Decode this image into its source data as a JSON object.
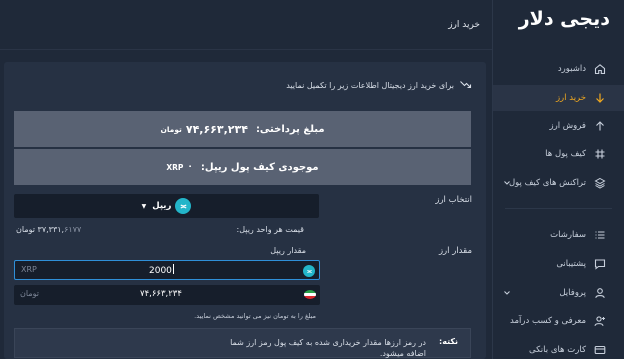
{
  "app": {
    "logo": "دیجی دلار"
  },
  "header": {
    "title": "خرید ارز"
  },
  "sidebar": {
    "items": [
      {
        "label": "داشبورد",
        "icon": "home-icon"
      },
      {
        "label": "خرید ارز",
        "icon": "arrow-down-icon",
        "active": true
      },
      {
        "label": "فروش ارز",
        "icon": "arrow-up-icon"
      },
      {
        "label": "کیف پول ها",
        "icon": "hash-icon"
      },
      {
        "label": "تراکنش های کیف پول",
        "icon": "layers-icon",
        "has_submenu": true
      },
      {
        "label": "سفارشات",
        "icon": "list-icon"
      },
      {
        "label": "پشتیبانی",
        "icon": "chat-icon"
      },
      {
        "label": "پروفایل",
        "icon": "user-icon",
        "has_submenu": true
      },
      {
        "label": "معرفی و کسب درآمد",
        "icon": "user-plus-icon"
      },
      {
        "label": "کارت های بانکی",
        "icon": "card-icon"
      }
    ]
  },
  "main": {
    "intro": "برای خرید ارز دیجیتال اطلاعات زیر را تکمیل نمایید",
    "payment": {
      "label": "مبلغ پرداختی:",
      "value": "۷۴,۶۶۳,۲۳۴",
      "unit": "تومان"
    },
    "balance": {
      "label": "موجودی کیف پول ریپل:",
      "value": "۰",
      "unit": "XRP"
    },
    "currency_select": {
      "label": "انتخاب ارز",
      "selected": "ریپل",
      "caret": "▼",
      "icon": "ripple-icon"
    },
    "rate": {
      "label": "قیمت هر واحد ریپل:",
      "value_int": "۳۷,۳۳۱,",
      "value_dec": "۶۱۷۷",
      "unit": "تومان"
    },
    "amount": {
      "label": "مقدار ارز",
      "sub_label": "مقدار ریپل",
      "crypto_placeholder": "XRP",
      "crypto_value": "2000",
      "toman_placeholder": "تومان",
      "toman_value": "۷۴,۶۶۳,۲۳۴",
      "help": "مبلغ را به تومان نیز می توانید مشخص نمایید."
    },
    "note": {
      "title": "نکته:",
      "text": "در رمز ارزها مقدار خریداری شده به کیف پول رمز ارز شما اضافه میشود."
    }
  },
  "colors": {
    "background": "#1f2939",
    "card": "#263143",
    "summary": "#596273",
    "input": "#161e2b",
    "accent": "#f2a91f",
    "ripple": "#23b5c9",
    "focus": "#2f8fd8"
  }
}
